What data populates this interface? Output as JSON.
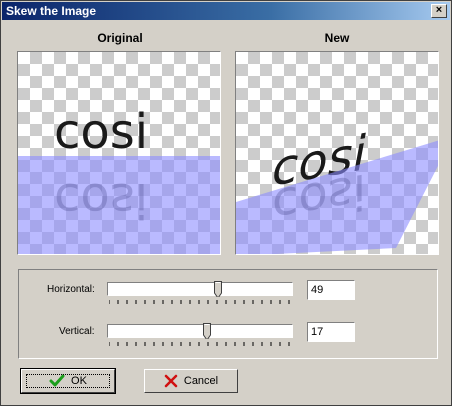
{
  "dialog": {
    "title": "Skew the Image",
    "close_glyph": "×"
  },
  "preview": {
    "original_label": "Original",
    "new_label": "New",
    "sample_text": "cosi",
    "overlay_color": "#8c8cff"
  },
  "controls": {
    "horizontal": {
      "label": "Horizontal:",
      "value": "49"
    },
    "vertical": {
      "label": "Vertical:",
      "value": "17"
    }
  },
  "buttons": {
    "ok_label": "OK",
    "cancel_label": "Cancel",
    "ok_icon": "checkmark-icon",
    "cancel_icon": "red-x-icon"
  }
}
